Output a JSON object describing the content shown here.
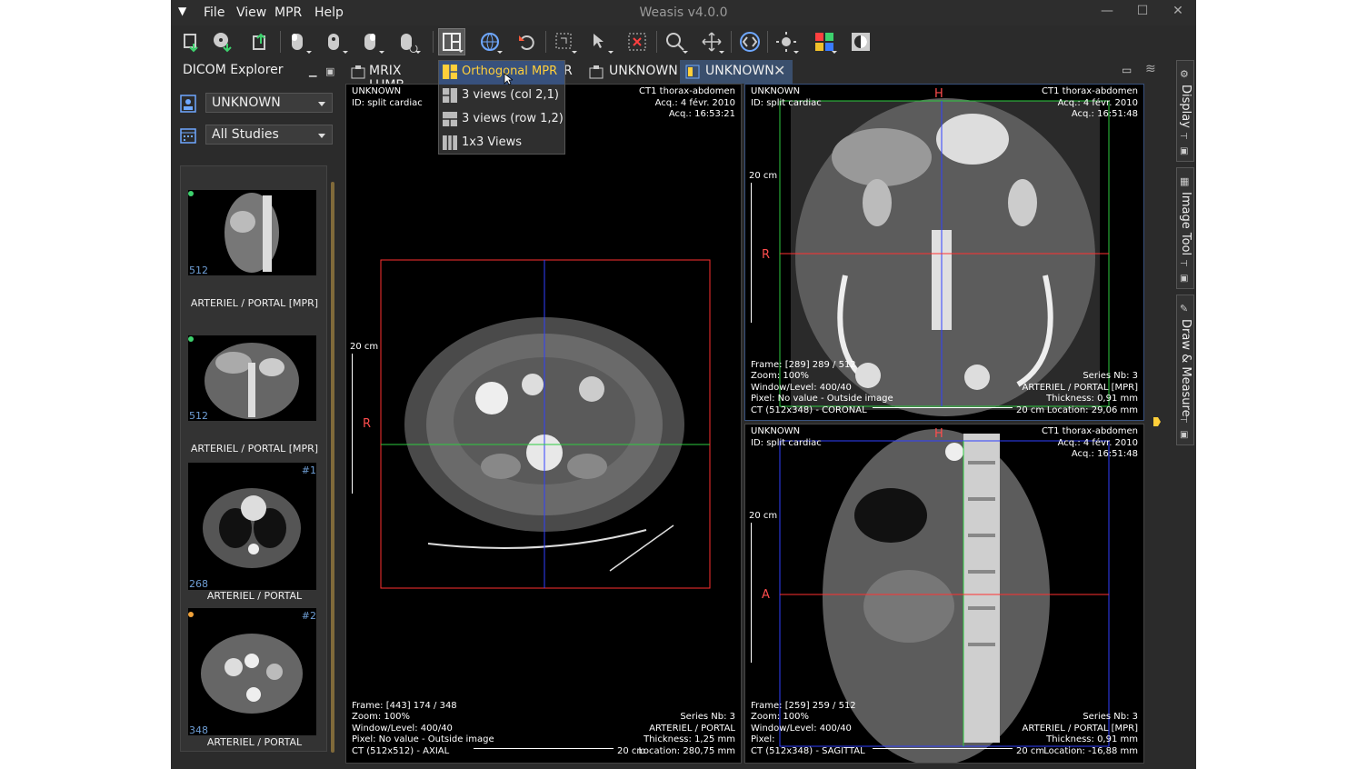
{
  "app": {
    "title": "Weasis v4.0.0",
    "menus": [
      "File",
      "View",
      "MPR",
      "Help"
    ]
  },
  "left_panel": {
    "title": "DICOM Explorer",
    "patient_combo": "UNKNOWN",
    "studies_combo": "All Studies"
  },
  "thumbnails": [
    {
      "label": "ARTERIEL / PORTAL [MPR]",
      "slices": "512",
      "num": "",
      "dot_color": "#3dd16d"
    },
    {
      "label": "ARTERIEL / PORTAL [MPR]",
      "slices": "512",
      "num": "",
      "dot_color": "#3dd16d"
    },
    {
      "label": "ARTERIEL / PORTAL",
      "slices": "268",
      "num": "#1",
      "dot_color": ""
    },
    {
      "label": "ARTERIEL / PORTAL",
      "slices": "348",
      "num": "#2",
      "dot_color": "#f0a23a"
    }
  ],
  "tabs": [
    {
      "label": "MRIX LUMB"
    },
    {
      "label": "R"
    },
    {
      "label": "UNKNOWN"
    },
    {
      "label": "UNKNOWN"
    }
  ],
  "dropdown": {
    "items": [
      "Orthogonal MPR",
      "3 views (col 2,1)",
      "3 views (row 1,2)",
      "1x3 Views"
    ]
  },
  "right_rail": {
    "tabs": [
      "Display",
      "Image Tool",
      "Draw & Measure"
    ]
  },
  "views": {
    "axial": {
      "tl": [
        "UNKNOWN",
        "ID: split cardiac"
      ],
      "tr": [
        "CT1 thorax-abdomen",
        "Acq.: 4 févr. 2010",
        "Acq.: 16:53:21"
      ],
      "bl": [
        "Frame: [443] 174 / 348",
        "Zoom: 100%",
        "Window/Level: 400/40",
        "Pixel: No value - Outside image",
        "CT (512x512) - AXIAL"
      ],
      "br": [
        "Series Nb: 3",
        "ARTERIEL / PORTAL",
        "Thickness: 1,25 mm",
        "Location: 280,75 mm"
      ],
      "scale": "20 cm",
      "orient_left": "R",
      "scale_bottom": "20 cm"
    },
    "coronal": {
      "tl": [
        "UNKNOWN",
        "ID: split cardiac"
      ],
      "tr": [
        "CT1 thorax-abdomen",
        "Acq.: 4 févr. 2010",
        "Acq.: 16:51:48"
      ],
      "bl": [
        "Frame: [289] 289 / 512",
        "Zoom: 100%",
        "Window/Level: 400/40",
        "Pixel: No value - Outside image",
        "CT (512x348) - CORONAL"
      ],
      "br": [
        "Series Nb: 3",
        "ARTERIEL / PORTAL [MPR]",
        "Thickness: 0,91 mm",
        "Location: 29,06 mm"
      ],
      "scale": "20 cm",
      "orient_left": "R",
      "orient_top": "H",
      "scale_bottom": "20 cm"
    },
    "sagittal": {
      "tl": [
        "UNKNOWN",
        "ID: split cardiac"
      ],
      "tr": [
        "CT1 thorax-abdomen",
        "Acq.: 4 févr. 2010",
        "Acq.: 16:51:48"
      ],
      "bl": [
        "Frame: [259] 259 / 512",
        "Zoom: 100%",
        "Window/Level: 400/40",
        "Pixel:",
        "CT (512x348) - SAGITTAL"
      ],
      "br": [
        "Series Nb: 3",
        "ARTERIEL / PORTAL [MPR]",
        "Thickness: 0,91 mm",
        "Location: -16,88 mm"
      ],
      "scale": "20 cm",
      "orient_left": "A",
      "orient_top": "H",
      "scale_bottom": "20 cm"
    }
  },
  "colors": {
    "accent": "#38517d",
    "highlight": "#ffcf3a",
    "crosshair_red": "#ff3030",
    "crosshair_green": "#2ecc40",
    "crosshair_blue": "#3040ff"
  }
}
